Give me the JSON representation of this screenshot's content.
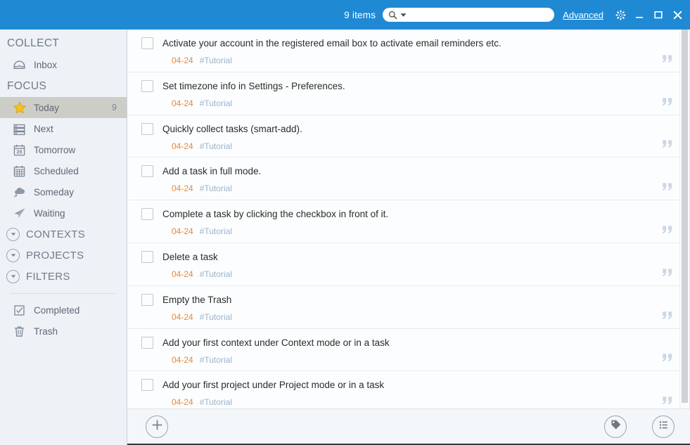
{
  "titlebar": {
    "items_count": "9 items",
    "search_value": "",
    "search_placeholder": "",
    "advanced_label": "Advanced",
    "icons": {
      "search": "search-icon",
      "dropdown": "chevron-down-icon",
      "settings": "gear-icon",
      "minimize": "minimize-icon",
      "maximize": "maximize-icon",
      "close": "close-icon"
    },
    "accent_color": "#2089d3"
  },
  "sidebar": {
    "collect_header": "COLLECT",
    "focus_header": "FOCUS",
    "collect_items": [
      {
        "label": "Inbox",
        "icon": "inbox-icon",
        "count": ""
      }
    ],
    "focus_items": [
      {
        "label": "Today",
        "icon": "star-icon",
        "count": "9",
        "active": true
      },
      {
        "label": "Next",
        "icon": "next-list-icon",
        "count": "",
        "active": false
      },
      {
        "label": "Tomorrow",
        "icon": "calendar-28-icon",
        "count": "",
        "active": false
      },
      {
        "label": "Scheduled",
        "icon": "calendar-grid-icon",
        "count": "",
        "active": false
      },
      {
        "label": "Someday",
        "icon": "cloud-icon",
        "count": "",
        "active": false
      },
      {
        "label": "Waiting",
        "icon": "paper-plane-icon",
        "count": "",
        "active": false
      }
    ],
    "groups": [
      {
        "label": "CONTEXTS",
        "icon": "chevron-down-circle-icon"
      },
      {
        "label": "PROJECTS",
        "icon": "chevron-down-circle-icon"
      },
      {
        "label": "FILTERS",
        "icon": "chevron-down-circle-icon"
      }
    ],
    "bottom_items": [
      {
        "label": "Completed",
        "icon": "checkbox-checked-icon"
      },
      {
        "label": "Trash",
        "icon": "trash-icon"
      }
    ],
    "active_highlight_color": "#cdcdc8",
    "background_color": "#eef2f7"
  },
  "list": {
    "date_color": "#e8883a",
    "tag_color": "#9fb3c8",
    "tasks": [
      {
        "title": "Activate your account in the registered email box to activate email reminders etc.",
        "date": "04-24",
        "tag": "#Tutorial",
        "note_icon": "quote-icon",
        "checked": false
      },
      {
        "title": "Set timezone info in Settings - Preferences.",
        "date": "04-24",
        "tag": "#Tutorial",
        "note_icon": "quote-icon",
        "checked": false
      },
      {
        "title": "Quickly collect tasks (smart-add).",
        "date": "04-24",
        "tag": "#Tutorial",
        "note_icon": "quote-icon",
        "checked": false
      },
      {
        "title": "Add a task in full mode.",
        "date": "04-24",
        "tag": "#Tutorial",
        "note_icon": "quote-icon",
        "checked": false
      },
      {
        "title": "Complete a task by clicking the checkbox in front of it.",
        "date": "04-24",
        "tag": "#Tutorial",
        "note_icon": "quote-icon",
        "checked": false
      },
      {
        "title": "Delete a task",
        "date": "04-24",
        "tag": "#Tutorial",
        "note_icon": "quote-icon",
        "checked": false
      },
      {
        "title": "Empty the Trash",
        "date": "04-24",
        "tag": "#Tutorial",
        "note_icon": "quote-icon",
        "checked": false
      },
      {
        "title": "Add your first context under Context mode or in a task",
        "date": "04-24",
        "tag": "#Tutorial",
        "note_icon": "quote-icon",
        "checked": false
      },
      {
        "title": "Add your first project under Project mode or in a task",
        "date": "04-24",
        "tag": "#Tutorial",
        "note_icon": "quote-icon",
        "checked": false
      }
    ]
  },
  "bottombar": {
    "add_icon": "plus-circle-icon",
    "tag_icon": "tag-icon",
    "view_icon": "list-view-icon"
  }
}
